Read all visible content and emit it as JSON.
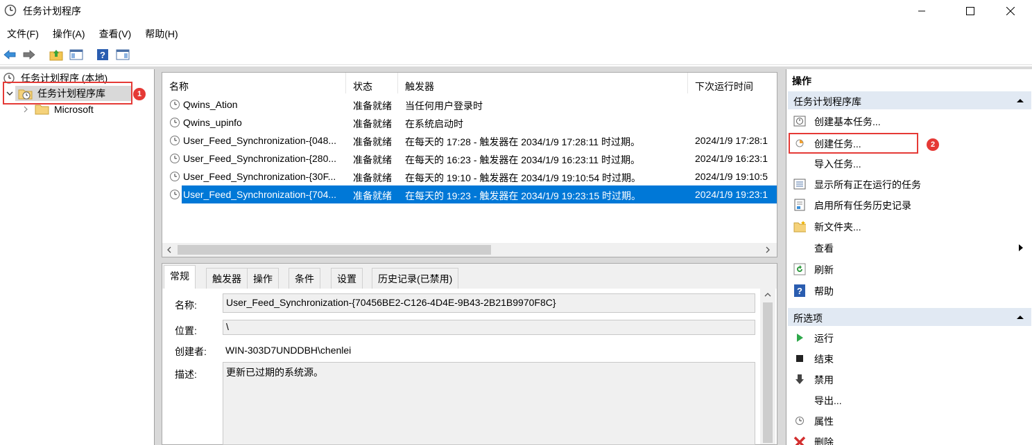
{
  "window": {
    "title": "任务计划程序"
  },
  "menu": [
    "文件(F)",
    "操作(A)",
    "查看(V)",
    "帮助(H)"
  ],
  "tree": {
    "root": "任务计划程序 (本地)",
    "library": "任务计划程序库",
    "child": "Microsoft"
  },
  "task_list": {
    "columns": [
      "名称",
      "状态",
      "触发器",
      "下次运行时间"
    ],
    "rows": [
      {
        "name": "Qwins_Ation",
        "status": "准备就绪",
        "trigger": "当任何用户登录时",
        "next": ""
      },
      {
        "name": "Qwins_upinfo",
        "status": "准备就绪",
        "trigger": "在系统启动时",
        "next": ""
      },
      {
        "name": "User_Feed_Synchronization-{048...",
        "status": "准备就绪",
        "trigger": "在每天的 17:28 - 触发器在 2034/1/9 17:28:11 时过期。",
        "next": "2024/1/9 17:28:1"
      },
      {
        "name": "User_Feed_Synchronization-{280...",
        "status": "准备就绪",
        "trigger": "在每天的 16:23 - 触发器在 2034/1/9 16:23:11 时过期。",
        "next": "2024/1/9 16:23:1"
      },
      {
        "name": "User_Feed_Synchronization-{30F...",
        "status": "准备就绪",
        "trigger": "在每天的 19:10 - 触发器在 2034/1/9 19:10:54 时过期。",
        "next": "2024/1/9 19:10:5"
      },
      {
        "name": "User_Feed_Synchronization-{704...",
        "status": "准备就绪",
        "trigger": "在每天的 19:23 - 触发器在 2034/1/9 19:23:15 时过期。",
        "next": "2024/1/9 19:23:1"
      }
    ]
  },
  "details": {
    "tabs": [
      "常规",
      "触发器",
      "操作",
      "条件",
      "设置",
      "历史记录(已禁用)"
    ],
    "name_label": "名称:",
    "name_value": "User_Feed_Synchronization-{70456BE2-C126-4D4E-9B43-2B21B9970F8C}",
    "location_label": "位置:",
    "location_value": "\\",
    "author_label": "创建者:",
    "author_value": "WIN-303D7UNDDBH\\chenlei",
    "desc_label": "描述:",
    "desc_value": "更新已过期的系统源。"
  },
  "actions": {
    "title": "操作",
    "section1": "任务计划程序库",
    "items1": [
      "创建基本任务...",
      "创建任务...",
      "导入任务...",
      "显示所有正在运行的任务",
      "启用所有任务历史记录",
      "新文件夹...",
      "查看",
      "刷新",
      "帮助"
    ],
    "section2": "所选项",
    "items2": [
      "运行",
      "结束",
      "禁用",
      "导出...",
      "属性",
      "删除"
    ]
  },
  "annotations": [
    "1",
    "2"
  ],
  "colors": {
    "selection": "#0078d7",
    "highlight": "#e53935",
    "section_bg": "#e1e9f3"
  }
}
